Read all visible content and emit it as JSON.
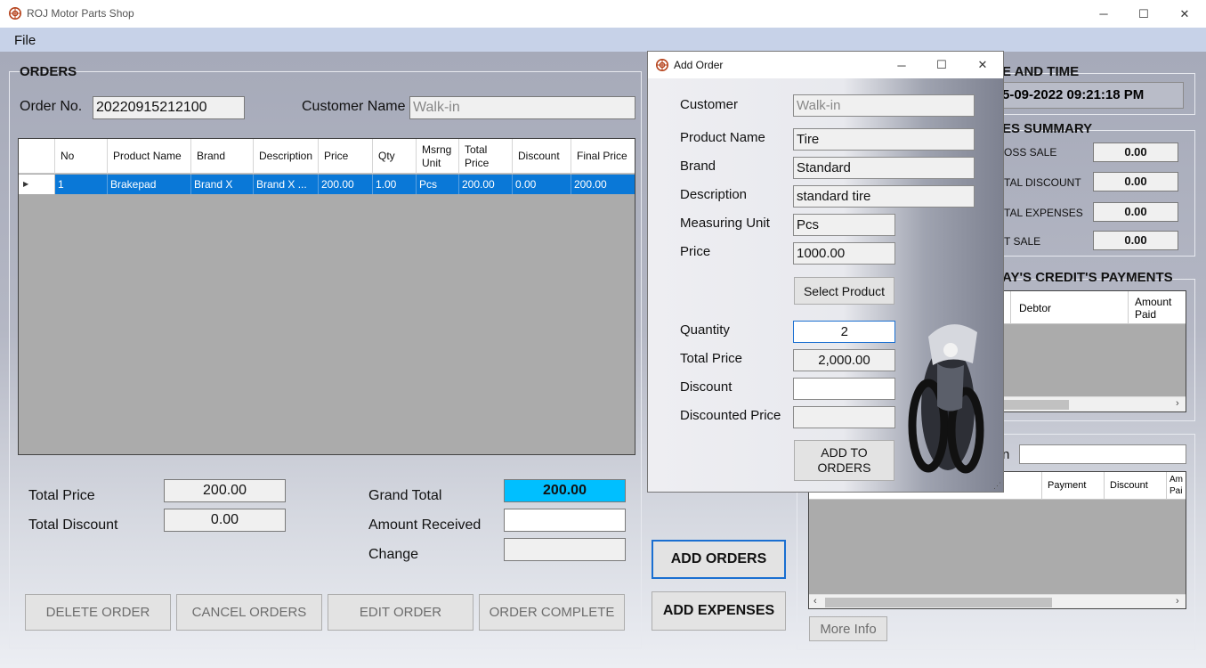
{
  "window": {
    "title": "ROJ Motor Parts Shop",
    "minimize": "─",
    "maximize": "☐",
    "close": "✕"
  },
  "menu": {
    "file": "File"
  },
  "orders": {
    "group_title": "ORDERS",
    "order_no_label": "Order No.",
    "order_no": "20220915212100",
    "customer_label": "Customer Name",
    "customer": "Walk-in",
    "columns": [
      "No",
      "Product Name",
      "Brand",
      "Description",
      "Price",
      "Qty",
      "Msrng Unit",
      "Total Price",
      "Discount",
      "Final Price"
    ],
    "rows": [
      [
        "1",
        "Brakepad",
        "Brand X",
        "Brand X ...",
        "200.00",
        "1.00",
        "Pcs",
        "200.00",
        "0.00",
        "200.00"
      ]
    ],
    "row_marker": "▶",
    "total_price_label": "Total Price",
    "total_price": "200.00",
    "total_discount_label": "Total Discount",
    "total_discount": "0.00",
    "grand_total_label": "Grand Total",
    "grand_total": "200.00",
    "amount_received_label": "Amount Received",
    "amount_received": "",
    "change_label": "Change",
    "change": "",
    "buttons": {
      "delete": "DELETE ORDER",
      "cancel": "CANCEL ORDERS",
      "edit": "EDIT ORDER",
      "complete": "ORDER COMPLETE",
      "add_orders": "ADD ORDERS",
      "add_expenses": "ADD EXPENSES"
    }
  },
  "right_panel": {
    "datetime_title": "E AND TIME",
    "datetime_value": "5-09-2022  09:21:18 PM",
    "sales_title": "ES SUMMARY",
    "gross_label": "OSS SALE",
    "gross": "0.00",
    "discount_label": "TAL DISCOUNT",
    "discount": "0.00",
    "expenses_label": "TAL EXPENSES",
    "expenses": "0.00",
    "net_label": "T SALE",
    "net": "0.00",
    "credit_title": "AY'S CREDIT'S PAYMENTS",
    "credit_columns": [
      "Debtor",
      "Amount Paid"
    ],
    "search_label_fragment": "n",
    "search_value": "",
    "list_columns": [
      "Payment",
      "Discount",
      "Am Pai"
    ],
    "more_info": "More Info"
  },
  "dialog": {
    "title": "Add Order",
    "minimize": "─",
    "maximize": "☐",
    "close": "✕",
    "customer_label": "Customer",
    "customer": "Walk-in",
    "product_name_label": "Product Name",
    "product_name": "Tire",
    "brand_label": "Brand",
    "brand": "Standard",
    "description_label": "Description",
    "description": "standard tire",
    "unit_label": "Measuring Unit",
    "unit": "Pcs",
    "price_label": "Price",
    "price": "1000.00",
    "select_product": "Select Product",
    "quantity_label": "Quantity",
    "quantity": "2",
    "total_price_label": "Total Price",
    "total_price": "2,000.00",
    "discount_label": "Discount",
    "discount": "",
    "discounted_price_label": "Discounted Price",
    "discounted_price": "",
    "add_to_orders": "ADD TO ORDERS"
  },
  "colors": {
    "selection": "#0a78d7",
    "grand_total_bg": "#00bfff",
    "menubar": "#c7d2e8"
  }
}
